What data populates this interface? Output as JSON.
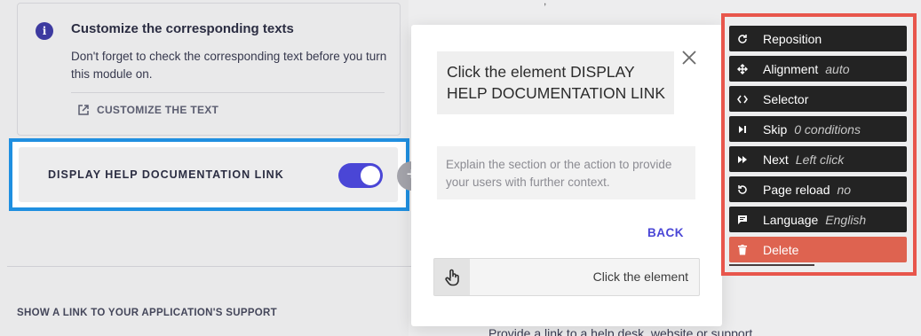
{
  "background": {
    "info_card": {
      "title": "Customize the corresponding texts",
      "body": "Don't forget to check the corresponding text before you turn this module on.",
      "link_label": "CUSTOMIZE THE TEXT"
    },
    "option_row": {
      "label": "DISPLAY HELP DOCUMENTATION LINK",
      "toggle_on": true
    },
    "plus_symbol": "+",
    "support_heading": "SHOW A LINK TO YOUR APPLICATION'S SUPPORT",
    "truncated_text": "Provide a link to a help desk, website or support"
  },
  "popup": {
    "title": "Click the element DISPLAY HELP DOCUMENTATION LINK",
    "description_placeholder": "Explain the section or the action to provide your users with further context.",
    "back_label": "BACK",
    "trigger_label": "Click the element"
  },
  "settings_panel": {
    "items": [
      {
        "label": "Reposition",
        "value": "",
        "icon": "reposition-icon"
      },
      {
        "label": "Alignment",
        "value": "auto",
        "icon": "alignment-icon"
      },
      {
        "label": "Selector",
        "value": "",
        "icon": "code-icon"
      },
      {
        "label": "Skip",
        "value": "0 conditions",
        "icon": "skip-icon"
      },
      {
        "label": "Next",
        "value": "Left click",
        "icon": "fast-forward-icon"
      },
      {
        "label": "Page reload",
        "value": "no",
        "icon": "reload-icon"
      },
      {
        "label": "Language",
        "value": "English",
        "icon": "chat-icon"
      },
      {
        "label": "Delete",
        "value": "",
        "icon": "trash-icon"
      }
    ]
  },
  "colors": {
    "accent": "#4a46d6",
    "highlight_border": "#1f8fe0",
    "panel_border": "#e8564c",
    "delete_bg": "#de6350",
    "menu_bg": "#232323"
  }
}
